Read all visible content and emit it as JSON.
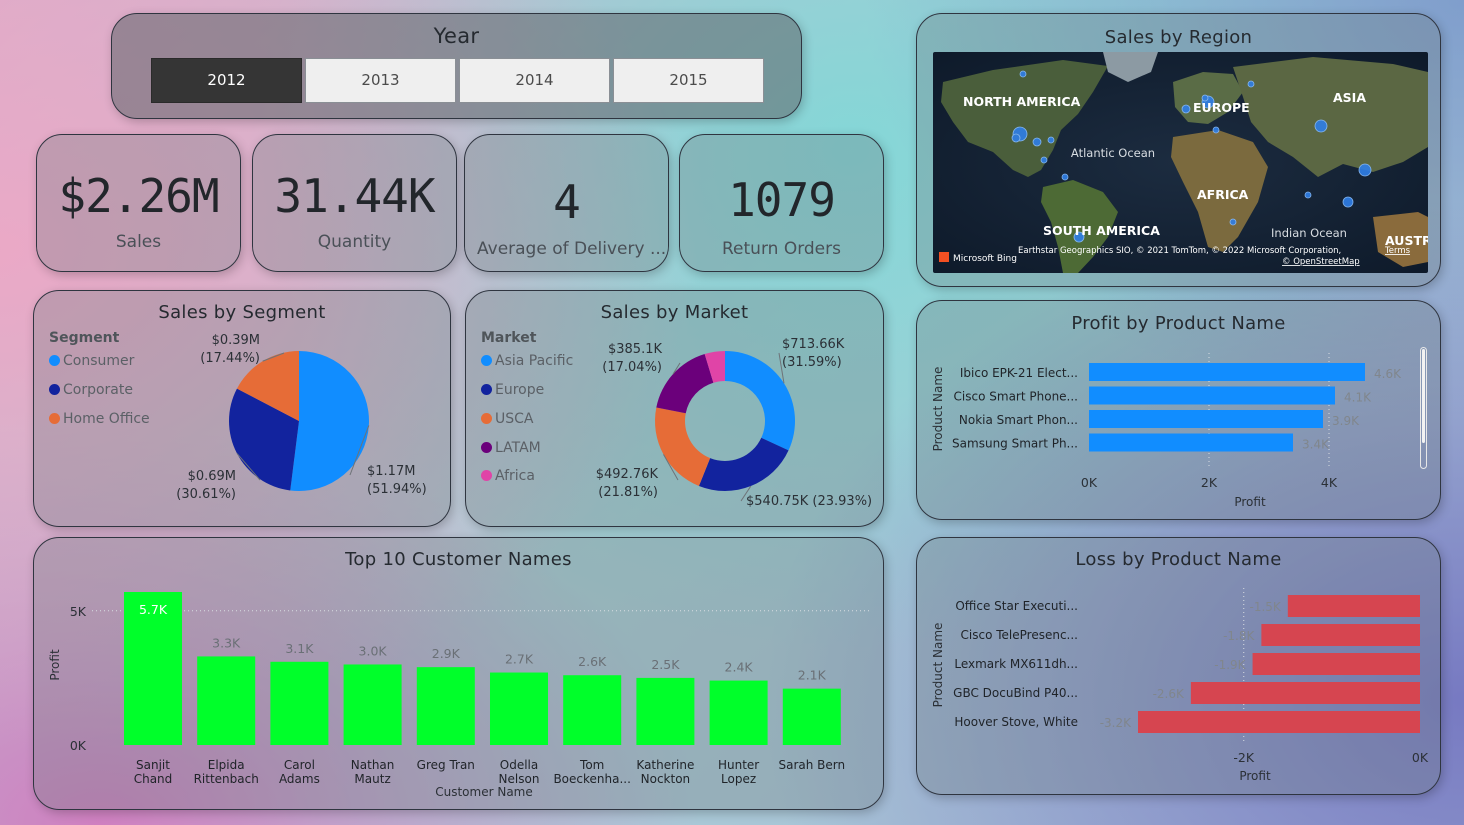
{
  "year_slicer": {
    "title": "Year",
    "options": [
      "2012",
      "2013",
      "2014",
      "2015"
    ],
    "selected": "2012"
  },
  "kpis": [
    {
      "value": "$2.26M",
      "label": "Sales"
    },
    {
      "value": "31.44K",
      "label": "Quantity"
    },
    {
      "value": "4",
      "label": "Average of Delivery ..."
    },
    {
      "value": "1079",
      "label": "Return Orders"
    }
  ],
  "map": {
    "title": "Sales by Region",
    "labels": {
      "north_america": "NORTH AMERICA",
      "europe": "EUROPE",
      "asia": "ASIA",
      "atlantic": "Atlantic Ocean",
      "africa": "AFRICA",
      "south_america": "SOUTH AMERICA",
      "indian": "Indian Ocean",
      "australia": "AUSTRAL"
    },
    "attribution": "Earthstar Geographics SIO, © 2021 TomTom, © 2022 Microsoft Corporation,",
    "terms": "Terms",
    "osm": "© OpenStreetMap",
    "bing": "Microsoft Bing"
  },
  "colors": {
    "blue": "#118dff",
    "navy": "#12239e",
    "orange": "#e66c37",
    "purple": "#6b007b",
    "pink": "#e044a7",
    "green": "#00ff2a",
    "red": "#d64550"
  },
  "chart_data": [
    {
      "id": "segment",
      "type": "pie",
      "title": "Sales by Segment",
      "legend_title": "Segment",
      "categories": [
        "Consumer",
        "Corporate",
        "Home Office"
      ],
      "values": [
        1.17,
        0.69,
        0.39
      ],
      "value_labels": [
        "$1.17M",
        "$0.69M",
        "$0.39M"
      ],
      "percent_labels": [
        "(51.94%)",
        "(30.61%)",
        "(17.44%)"
      ],
      "colors": [
        "#118dff",
        "#12239e",
        "#e66c37"
      ]
    },
    {
      "id": "market",
      "type": "pie",
      "subtype": "donut",
      "title": "Sales by Market",
      "legend_title": "Market",
      "categories": [
        "Asia Pacific",
        "Europe",
        "USCA",
        "LATAM",
        "Africa"
      ],
      "values": [
        713.66,
        540.75,
        492.76,
        385.1,
        105.0
      ],
      "value_labels": [
        "$713.66K",
        "$540.75K",
        "$492.76K",
        "$385.1K",
        ""
      ],
      "percent_labels": [
        "(31.59%)",
        "(23.93%)",
        "(21.81%)",
        "(17.04%)",
        ""
      ],
      "colors": [
        "#118dff",
        "#12239e",
        "#e66c37",
        "#6b007b",
        "#e044a7"
      ]
    },
    {
      "id": "profit_product",
      "type": "bar",
      "orientation": "horizontal",
      "title": "Profit by Product Name",
      "xlabel": "Profit",
      "ylabel": "Product Name",
      "categories": [
        "Ibico EPK-21 Elect...",
        "Cisco Smart Phone...",
        "Nokia Smart Phon...",
        "Samsung Smart Ph..."
      ],
      "values": [
        4.6,
        4.1,
        3.9,
        3.4
      ],
      "data_labels": [
        "4.6K",
        "4.1K",
        "3.9K",
        "3.4K"
      ],
      "xticks": [
        "0K",
        "2K",
        "4K"
      ],
      "xlim": [
        0,
        4.6
      ],
      "grid": true
    },
    {
      "id": "top_customers",
      "type": "bar",
      "title": "Top 10 Customer Names",
      "xlabel": "Customer Name",
      "ylabel": "Profit",
      "categories": [
        [
          "Sanjit",
          "Chand"
        ],
        [
          "Elpida",
          "Rittenbach"
        ],
        [
          "Carol",
          "Adams"
        ],
        [
          "Nathan",
          "Mautz"
        ],
        [
          "Greg Tran"
        ],
        [
          "Odella",
          "Nelson"
        ],
        [
          "Tom",
          "Boeckenha..."
        ],
        [
          "Katherine",
          "Nockton"
        ],
        [
          "Hunter",
          "Lopez"
        ],
        [
          "Sarah Bern"
        ]
      ],
      "values": [
        5.7,
        3.3,
        3.1,
        3.0,
        2.9,
        2.7,
        2.6,
        2.5,
        2.4,
        2.1
      ],
      "data_labels": [
        "5.7K",
        "3.3K",
        "3.1K",
        "3.0K",
        "2.9K",
        "2.7K",
        "2.6K",
        "2.5K",
        "2.4K",
        "2.1K"
      ],
      "yticks": [
        "0K",
        "5K"
      ],
      "ylim": [
        0,
        5.7
      ],
      "grid": true
    },
    {
      "id": "loss_product",
      "type": "bar",
      "orientation": "horizontal",
      "title": "Loss by Product Name",
      "xlabel": "Profit",
      "ylabel": "Product Name",
      "categories": [
        "Office Star Executi...",
        "Cisco TelePresenc...",
        "Lexmark MX611dh...",
        "GBC DocuBind P40...",
        "Hoover Stove, White"
      ],
      "values": [
        -1.5,
        -1.8,
        -1.9,
        -2.6,
        -3.2
      ],
      "data_labels": [
        "-1.5K",
        "-1.8K",
        "-1.9K",
        "-2.6K",
        "-3.2K"
      ],
      "xticks": [
        "-2K",
        "0K"
      ],
      "xlim": [
        -3.2,
        0
      ],
      "grid": true
    }
  ]
}
